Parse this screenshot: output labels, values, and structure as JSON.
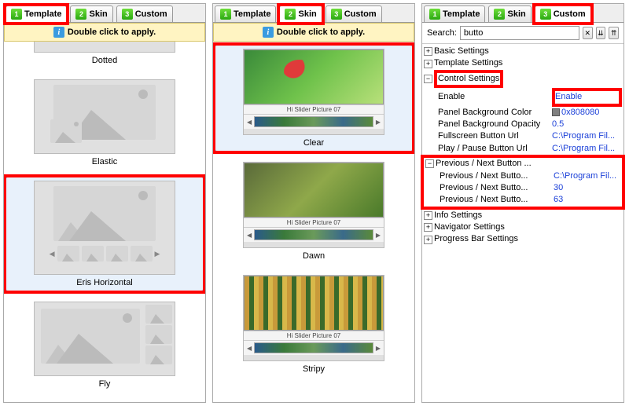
{
  "tabs": {
    "t1": "Template",
    "t2": "Skin",
    "t3": "Custom",
    "n1": "1",
    "n2": "2",
    "n3": "3"
  },
  "hint": {
    "text": "Double click to apply."
  },
  "templates": {
    "item0": "Dotted",
    "item1": "Elastic",
    "item2": "Eris Horizontal",
    "item3": "Fly"
  },
  "skins": {
    "item0": "Clear",
    "item1": "Dawn",
    "item2": "Stripy",
    "caption": "Hi Slider Picture 07"
  },
  "custom": {
    "search_label": "Search:",
    "search_value": "butto",
    "groups": {
      "basic": "Basic Settings",
      "template": "Template Settings",
      "control": "Control Settings",
      "prevnext": "Previous / Next Button ...",
      "info": "Info Settings",
      "navigator": "Navigator Settings",
      "progress": "Progress Bar Settings"
    },
    "control": {
      "enable_k": "Enable",
      "enable_v": "Enable",
      "pbg_k": "Panel Background Color",
      "pbg_v": "0x808080",
      "pbo_k": "Panel Background Opacity",
      "pbo_v": "0.5",
      "fsu_k": "Fullscreen Button Url",
      "fsu_v": "C:\\Program Fil...",
      "ppu_k": "Play / Pause Button Url",
      "ppu_v": "C:\\Program Fil..."
    },
    "prevnext": {
      "r1k": "Previous / Next Butto...",
      "r1v": "C:\\Program Fil...",
      "r2k": "Previous / Next Butto...",
      "r2v": "30",
      "r3k": "Previous / Next Butto...",
      "r3v": "63"
    }
  }
}
